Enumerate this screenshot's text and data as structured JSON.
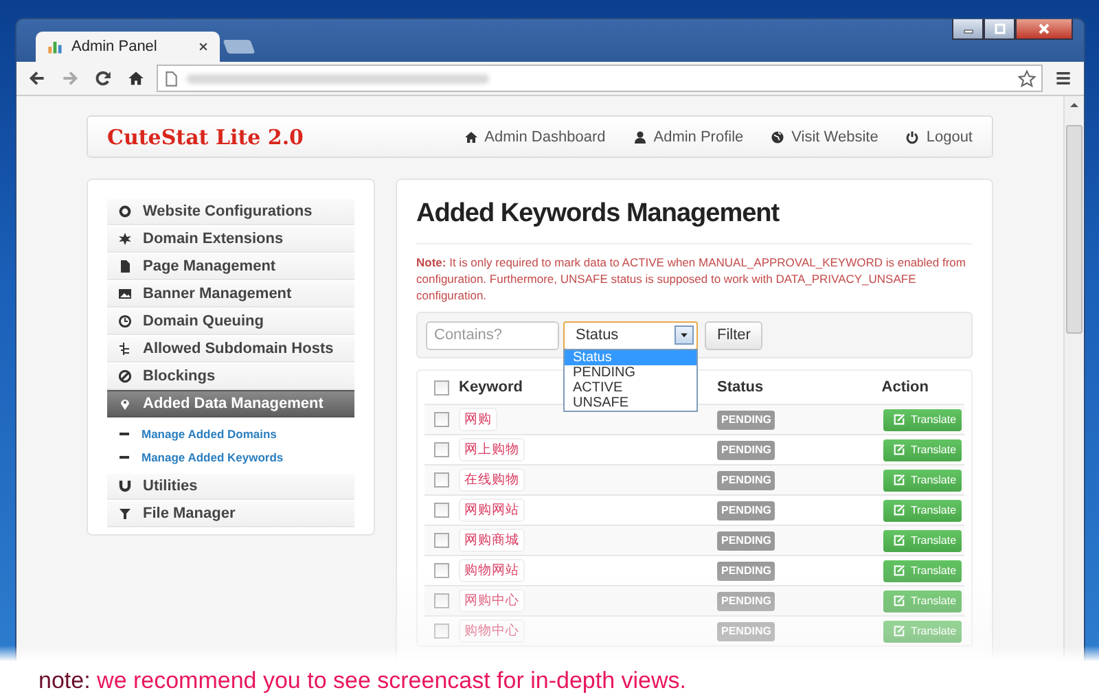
{
  "browser": {
    "tab_title": "Admin Panel"
  },
  "header": {
    "brand": "CuteStat Lite 2.0",
    "nav": [
      {
        "label": "Admin Dashboard"
      },
      {
        "label": "Admin Profile"
      },
      {
        "label": "Visit Website"
      },
      {
        "label": "Logout"
      }
    ]
  },
  "sidebar": {
    "items": [
      {
        "label": "Website Configurations",
        "selected": false
      },
      {
        "label": "Domain Extensions",
        "selected": false
      },
      {
        "label": "Page Management",
        "selected": false
      },
      {
        "label": "Banner Management",
        "selected": false
      },
      {
        "label": "Domain Queuing",
        "selected": false
      },
      {
        "label": "Allowed Subdomain Hosts",
        "selected": false
      },
      {
        "label": "Blockings",
        "selected": false
      },
      {
        "label": "Added Data Management",
        "selected": true,
        "children": [
          {
            "label": "Manage Added Domains"
          },
          {
            "label": "Manage Added Keywords"
          }
        ]
      },
      {
        "label": "Utilities",
        "selected": false
      },
      {
        "label": "File Manager",
        "selected": false
      }
    ]
  },
  "main": {
    "title": "Added Keywords Management",
    "note": "**Note:** It is only required to mark data to ACTIVE when MANUAL_APPROVAL_KEYWORD is enabled from configuration. Furthermore, UNSAFE status is supposed to work with DATA_PRIVACY_UNSAFE configuration.",
    "filter": {
      "placeholder": "Contains?",
      "select_value": "Status",
      "expanded": true,
      "options": [
        {
          "label": "Status",
          "selected": true
        },
        {
          "label": "PENDING",
          "selected": false
        },
        {
          "label": "ACTIVE",
          "selected": false
        },
        {
          "label": "UNSAFE",
          "selected": false
        }
      ],
      "button": "Filter"
    },
    "table": {
      "columns": [
        "Keyword",
        "Status",
        "Action"
      ],
      "select_all_checked": false,
      "rows": [
        {
          "keyword": "网购",
          "status": "PENDING",
          "action": "Translate",
          "checked": false
        },
        {
          "keyword": "网上购物",
          "status": "PENDING",
          "action": "Translate",
          "checked": false
        },
        {
          "keyword": "在线购物",
          "status": "PENDING",
          "action": "Translate",
          "checked": false
        },
        {
          "keyword": "网购网站",
          "status": "PENDING",
          "action": "Translate",
          "checked": false
        },
        {
          "keyword": "网购商城",
          "status": "PENDING",
          "action": "Translate",
          "checked": false
        },
        {
          "keyword": "购物网站",
          "status": "PENDING",
          "action": "Translate",
          "checked": false
        },
        {
          "keyword": "网购中心",
          "status": "PENDING",
          "action": "Translate",
          "checked": false
        },
        {
          "keyword": "购物中心",
          "status": "PENDING",
          "action": "Translate",
          "checked": false
        }
      ]
    }
  },
  "footer_note": "**note:** we recommend you to see screencast for in-depth views."
}
